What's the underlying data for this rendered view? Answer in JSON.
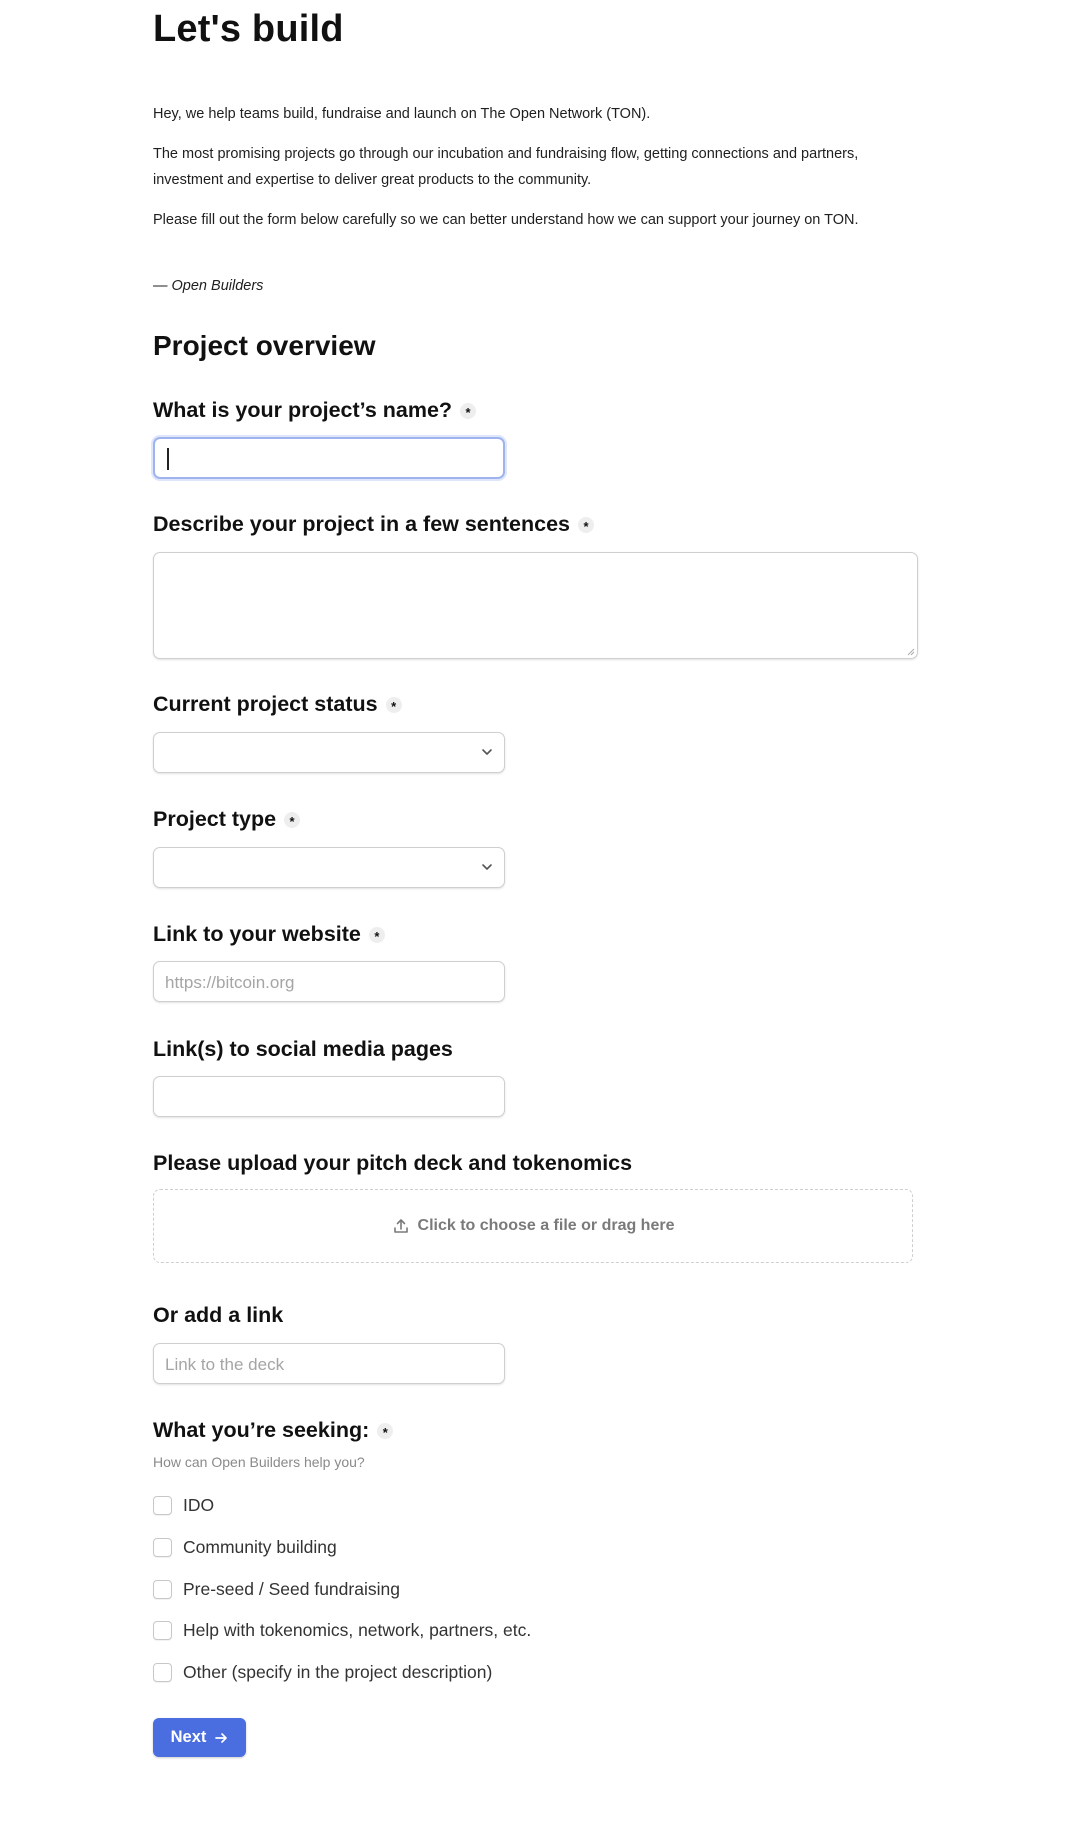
{
  "header": {
    "title": "Let's build"
  },
  "intro": {
    "p1": "Hey, we help teams build, fundraise and launch on The Open Network (TON).",
    "p2": "The most promising projects go through our incubation and fundraising flow, getting connections and partners, investment and expertise to deliver great products to the community.",
    "p3": "Please fill out the form below carefully so we can better understand how we can support your journey on TON.",
    "signature": "— Open Builders"
  },
  "section": {
    "title": "Project overview"
  },
  "fields": {
    "project_name": {
      "label": "What is your project’s name?",
      "value": "",
      "required": true
    },
    "description": {
      "label": "Describe your project in a few sentences",
      "value": "",
      "required": true
    },
    "status": {
      "label": "Current project status",
      "value": "",
      "required": true
    },
    "type": {
      "label": "Project type",
      "value": "",
      "required": true
    },
    "website": {
      "label": "Link to your website",
      "placeholder": "https://bitcoin.org",
      "required": true
    },
    "social": {
      "label": "Link(s) to social media pages",
      "value": ""
    },
    "upload": {
      "label": "Please upload your pitch deck and tokenomics",
      "dropzone_text": "Click to choose a file or drag here",
      "icon": "upload-icon"
    },
    "deck_link": {
      "label": "Or add a link",
      "placeholder": "Link to the deck"
    },
    "seeking": {
      "label": "What you’re seeking:",
      "hint": "How can Open Builders help you?",
      "required": true,
      "options": [
        "IDO",
        "Community building",
        "Pre-seed / Seed fundraising",
        "Help with tokenomics, network, partners, etc.",
        "Other (specify in the project description)"
      ]
    }
  },
  "required_marker": "*",
  "actions": {
    "next_label": "Next"
  },
  "colors": {
    "accent": "#4a6ee0",
    "focus_ring": "#9fb3ee"
  }
}
